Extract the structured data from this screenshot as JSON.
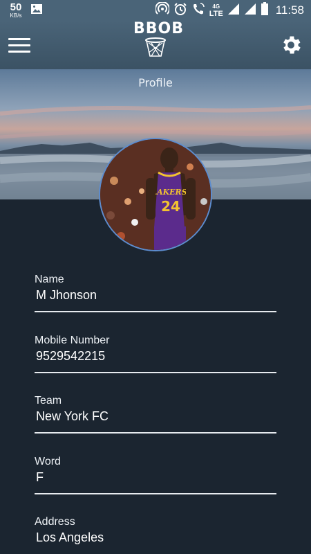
{
  "status_bar": {
    "net_speed_value": "50",
    "net_speed_unit": "KB/s",
    "network_type": "4G",
    "lte_label": "LTE",
    "time": "11:58",
    "icons": [
      "image-icon",
      "hotspot-icon",
      "alarm-icon",
      "wifi-call-icon",
      "signal-icon",
      "signal-icon",
      "battery-icon"
    ]
  },
  "app_bar": {
    "logo_text": "BBOB"
  },
  "hero": {
    "title": "Profile"
  },
  "profile": {
    "fields": [
      {
        "label": "Name",
        "value": "M Jhonson"
      },
      {
        "label": "Mobile Number",
        "value": "9529542215"
      },
      {
        "label": "Team",
        "value": "New York FC"
      },
      {
        "label": "Word",
        "value": "F"
      },
      {
        "label": "Address",
        "value": "Los Angeles"
      }
    ]
  },
  "colors": {
    "status_bar": "#4a6478",
    "app_bar": "#3b5264",
    "background": "#1b2530",
    "avatar_border": "#5d8dcf",
    "jersey_purple": "#5b2b8c",
    "jersey_gold": "#f2c230"
  }
}
